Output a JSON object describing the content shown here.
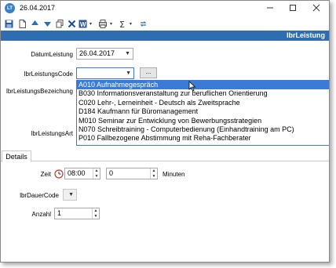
{
  "window": {
    "title": "26.04.2017",
    "app_icon_text": "LT"
  },
  "caption": "lbrLeistung",
  "fields": {
    "datum_label": "DatumLeistung",
    "datum_value": "26.04.2017",
    "code_label": "lbrLeistungsCode",
    "code_value": "",
    "code_button": "...",
    "bezeichnung_label": "lbrLeistungsBezeichung",
    "art_label": "lbrLeistungsArt"
  },
  "dropdown_items": [
    "A010 Aufnahmegespräch",
    "B030 Informationsveranstaltung zur beruflichen Orientierung",
    "C020 Lehr-, Lerneinheit - Deutsch als Zweitsprache",
    "D184 Kaufmann für Büromanagement",
    "M010 Seminar zur Entwicklung von Bewerbungsstrategien",
    "N070 Schreibtraining - Computerbedienung (Einhandtraining am PC)",
    "P010 Fallbezogene Abstimmung mit Reha-Fachberater"
  ],
  "details": {
    "tab_label": "Details",
    "zeit_label": "Zeit",
    "time_value": "08:00",
    "minutes_value": "0",
    "minutes_label": "Minuten",
    "dauer_label": "lbrDauerCode",
    "anzahl_label": "Anzahl",
    "anzahl_value": "1"
  },
  "colors": {
    "accent": "#2d6db0",
    "selection": "#3a7bd5"
  }
}
